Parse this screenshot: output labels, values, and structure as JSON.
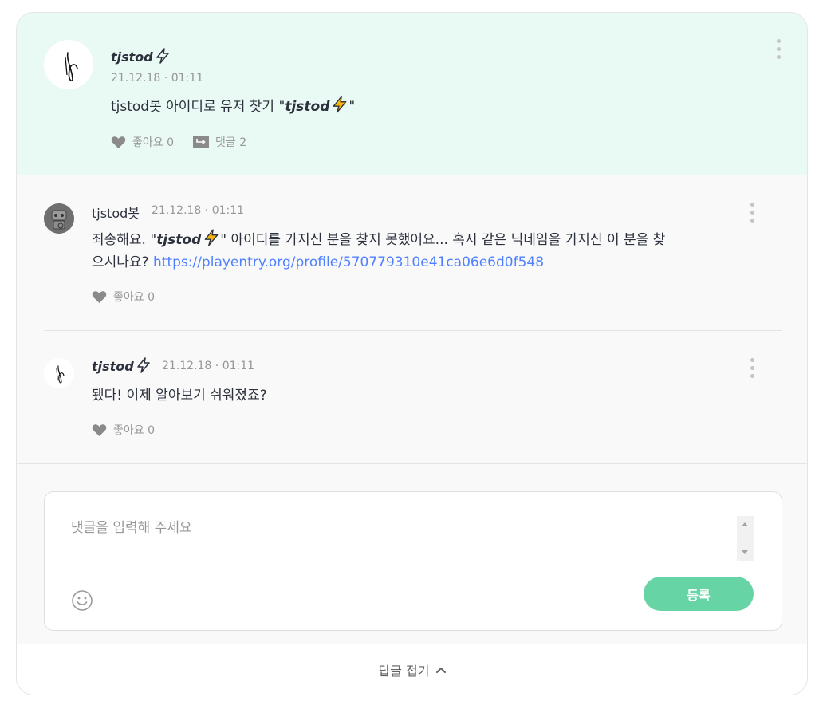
{
  "post": {
    "author": "tjstod",
    "time": "21.12.18 · 01:11",
    "text_before": "tjstod봇 아이디로 유저 찾기 \"",
    "text_em": "tjstod",
    "text_after": "\"",
    "like_label": "좋아요 0",
    "reply_label": "댓글 2"
  },
  "comments": [
    {
      "author": "tjstod봇",
      "time": "21.12.18 · 01:11",
      "text_a": "죄송해요. \"",
      "text_em": "tjstod",
      "text_b": "\" 아이디를 가지신 분을 찾지 못했어요... 혹시 같은 닉네임을 가지신 이 분을 찾",
      "text_c": "으시나요? ",
      "link": "https://playentry.org/profile/570779310e41ca06e6d0f548",
      "like_label": "좋아요 0"
    },
    {
      "author": "tjstod",
      "time": "21.12.18 · 01:11",
      "text": "됐다! 이제 알아보기 쉬워졌죠?",
      "like_label": "좋아요 0"
    }
  ],
  "input": {
    "placeholder": "댓글을 입력해 주세요",
    "submit_label": "등록"
  },
  "footer": {
    "fold_label": "답글 접기"
  },
  "colors": {
    "post_bg": "#e9f9f4",
    "accent": "#67d4a6",
    "link": "#4f80ff",
    "bolt": "#f5b50a"
  },
  "icons": [
    "lightning-icon",
    "heart-icon",
    "reply-icon",
    "more-icon",
    "emoji-icon",
    "chevron-up-icon"
  ]
}
